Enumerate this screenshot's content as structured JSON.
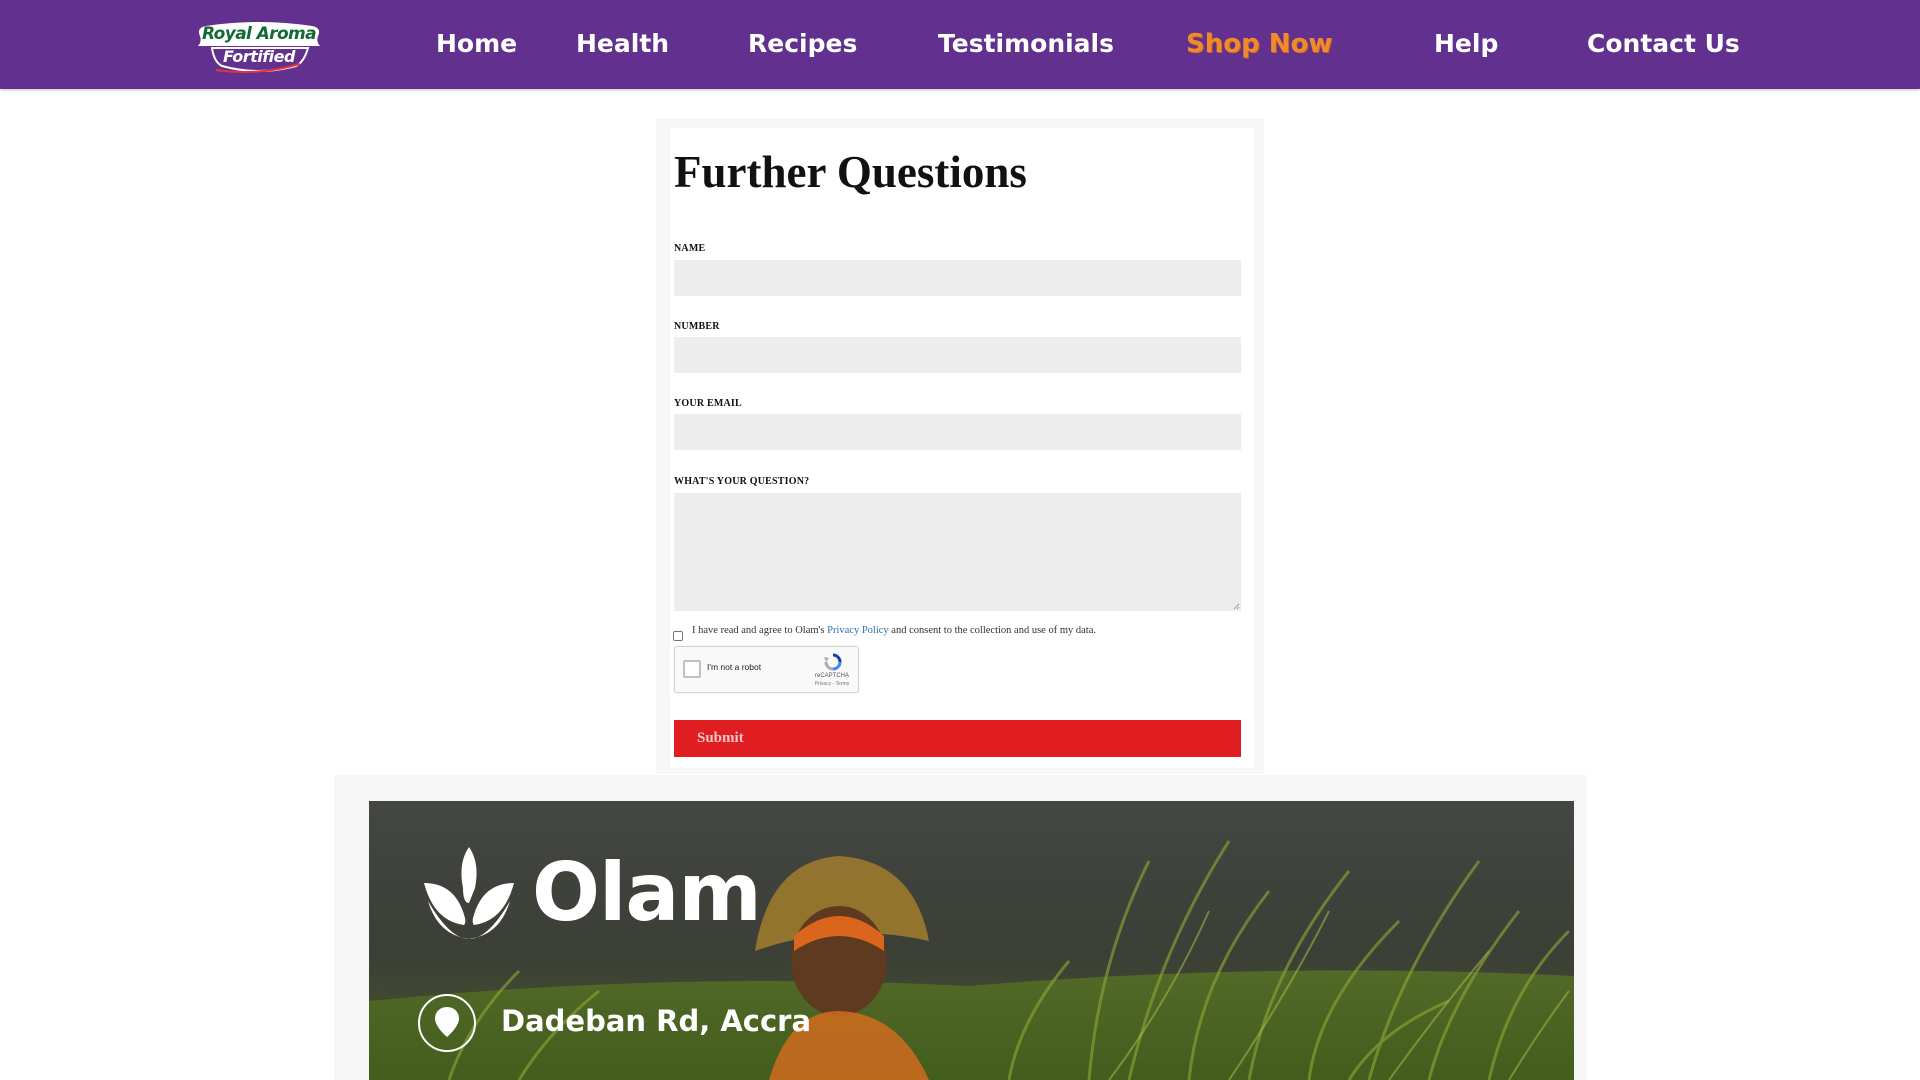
{
  "nav": {
    "logo": {
      "line1": "Royal Aroma",
      "line2": "Fortified"
    },
    "items": [
      {
        "label": "Home"
      },
      {
        "label": "Health"
      },
      {
        "label": "Recipes"
      },
      {
        "label": "Testimonials"
      },
      {
        "label": "Shop Now"
      },
      {
        "label": "Help"
      },
      {
        "label": "Contact Us"
      }
    ],
    "colors": {
      "background": "#62318f",
      "shop_now": "#f08a2d",
      "text": "#ffffff"
    }
  },
  "form": {
    "title": "Further Questions",
    "fields": {
      "name": {
        "label": "NAME",
        "value": ""
      },
      "number": {
        "label": "NUMBER",
        "value": ""
      },
      "email": {
        "label": "YOUR EMAIL",
        "value": ""
      },
      "question": {
        "label": "WHAT'S YOUR QUESTION?",
        "value": ""
      }
    },
    "consent": {
      "before": "I have read and agree to Olam's ",
      "link": "Privacy Policy",
      "after": "  and consent to the collection and use of my data.",
      "checked": false
    },
    "recaptcha": {
      "label": "I'm not a robot",
      "brand": "reCAPTCHA",
      "terms": "Privacy - Terms"
    },
    "submit_label": "Submit",
    "submit_color": "#e01e22"
  },
  "footer": {
    "brand": "Olam",
    "address": "Dadeban Rd, Accra",
    "icons": [
      "olam-leaf-icon",
      "location-pin-icon"
    ]
  }
}
